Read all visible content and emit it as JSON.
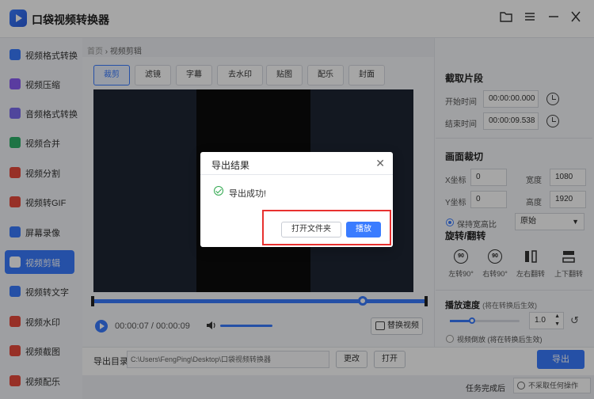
{
  "app": {
    "title": "口袋视频转换器"
  },
  "sidebar": {
    "items": [
      {
        "label": "视频格式转换",
        "color": "#3a7cff"
      },
      {
        "label": "视频压缩",
        "color": "#8a5cf6"
      },
      {
        "label": "音频格式转换",
        "color": "#7c6cf0"
      },
      {
        "label": "视频合并",
        "color": "#2fb36a"
      },
      {
        "label": "视频分割",
        "color": "#e94b3c"
      },
      {
        "label": "视频转GIF",
        "color": "#e94b3c"
      },
      {
        "label": "屏幕录像",
        "color": "#3a7cff"
      },
      {
        "label": "视频剪辑",
        "color": "#ffffff",
        "active": true
      },
      {
        "label": "视频转文字",
        "color": "#3a7cff"
      },
      {
        "label": "视频水印",
        "color": "#e94b3c"
      },
      {
        "label": "视频截图",
        "color": "#e94b3c"
      },
      {
        "label": "视频配乐",
        "color": "#e94b3c"
      }
    ]
  },
  "breadcrumb": {
    "home": "首页",
    "sep": "›",
    "current": "视频剪辑"
  },
  "tabs": [
    "裁剪",
    "滤镜",
    "字幕",
    "去水印",
    "贴图",
    "配乐",
    "封面"
  ],
  "player": {
    "time": "00:00:07 / 00:00:09",
    "replace_label": "替换视频",
    "progress_fraction": 0.81
  },
  "output": {
    "label": "导出目录",
    "path": "C:\\Users\\FengPing\\Desktop\\口袋视频转换器",
    "change_label": "更改",
    "open_label": "打开",
    "export_label": "导出"
  },
  "complete": {
    "label": "任务完成后",
    "value": "不采取任何操作"
  },
  "clip": {
    "title": "截取片段",
    "start_label": "开始时间",
    "start_value": "00:00:00.000",
    "end_label": "结束时间",
    "end_value": "00:00:09.538"
  },
  "crop": {
    "title": "画面裁切",
    "x_label": "X坐标",
    "x_value": "0",
    "width_label": "宽度",
    "width_value": "1080",
    "y_label": "Y坐标",
    "y_value": "0",
    "height_label": "高度",
    "height_value": "1920",
    "keep_ratio_label": "保持宽高比",
    "ratio_value": "原始"
  },
  "rotate": {
    "title": "旋转/翻转",
    "items": [
      {
        "label": "左转90°",
        "icon": "90"
      },
      {
        "label": "右转90°",
        "icon": "90"
      },
      {
        "label": "左右翻转",
        "icon": ""
      },
      {
        "label": "上下翻转",
        "icon": ""
      }
    ]
  },
  "speed": {
    "title": "播放速度",
    "note": "(将在转换后生效)",
    "value": "1.0",
    "reverse_label": "视频倒放",
    "reverse_note": "(将在转换后生效)"
  },
  "dialog": {
    "title": "导出结果",
    "message": "导出成功!",
    "open_folder_label": "打开文件夹",
    "play_label": "播放"
  }
}
